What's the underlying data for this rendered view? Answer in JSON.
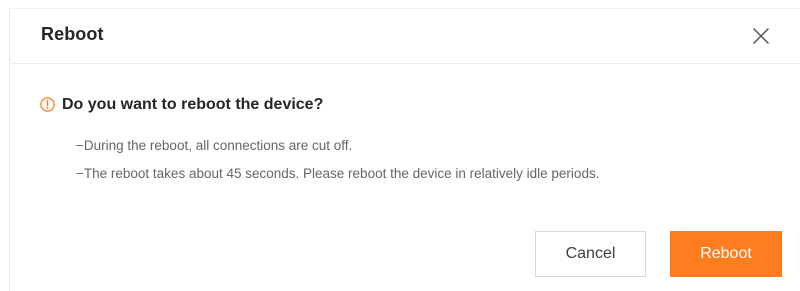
{
  "dialog": {
    "title": "Reboot",
    "close_icon": "close-icon",
    "warning_icon": "exclamation-circle-icon",
    "question": "Do you want to reboot the device?",
    "notes": [
      "−During the reboot, all connections are cut off.",
      "−The reboot takes about 45 seconds. Please reboot the device in relatively idle periods."
    ],
    "buttons": {
      "cancel_label": "Cancel",
      "confirm_label": "Reboot"
    }
  },
  "colors": {
    "accent": "#ff7d1e",
    "title_text": "#262626",
    "body_text": "#666666",
    "border": "#d9d9d9"
  }
}
